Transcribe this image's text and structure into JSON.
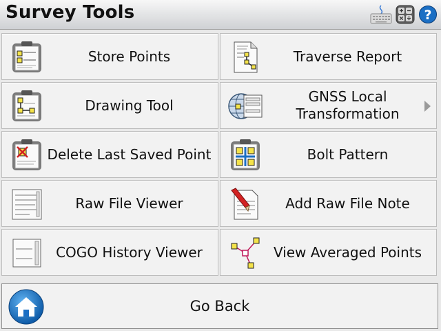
{
  "app": {
    "title": "Survey Tools"
  },
  "toolbar_icons": [
    "keyboard-icon",
    "calculator-icon",
    "help-icon"
  ],
  "menu": [
    {
      "label": "Store Points",
      "icon": "store-points-icon",
      "has_submenu": false
    },
    {
      "label": "Traverse Report",
      "icon": "traverse-report-icon",
      "has_submenu": false
    },
    {
      "label": "Drawing Tool",
      "icon": "drawing-tool-icon",
      "has_submenu": false
    },
    {
      "label": "GNSS Local Transformation",
      "icon": "gnss-transformation-icon",
      "has_submenu": true
    },
    {
      "label": "Delete Last Saved Point",
      "icon": "delete-point-icon",
      "has_submenu": false
    },
    {
      "label": "Bolt Pattern",
      "icon": "bolt-pattern-icon",
      "has_submenu": false
    },
    {
      "label": "Raw File Viewer",
      "icon": "raw-file-viewer-icon",
      "has_submenu": false
    },
    {
      "label": "Add Raw File Note",
      "icon": "raw-file-note-icon",
      "has_submenu": false
    },
    {
      "label": "COGO History Viewer",
      "icon": "cogo-history-icon",
      "has_submenu": false
    },
    {
      "label": "View Averaged Points",
      "icon": "averaged-points-icon",
      "has_submenu": false
    }
  ],
  "footer": {
    "go_back_label": "Go Back"
  },
  "colors": {
    "accent_blue": "#1b6fc4",
    "point_yellow": "#f4e34a",
    "delete_red": "#d22222"
  }
}
